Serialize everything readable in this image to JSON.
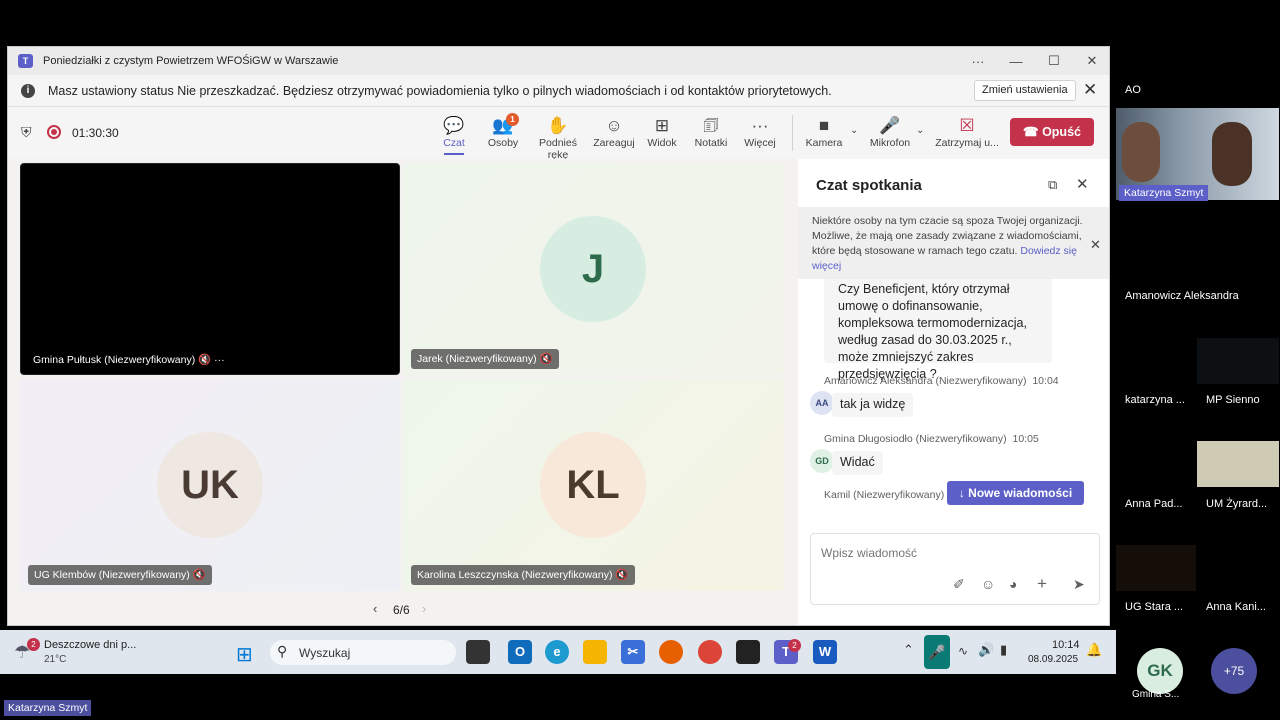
{
  "window": {
    "title": "Poniedziałki z czystym Powietrzem WFOŚiGW w Warszawie"
  },
  "notification": {
    "message": "Masz ustawiony status Nie przeszkadzać. Będziesz otrzymywać powiadomienia tylko o pilnych wiadomościach i od kontaktów priorytetowych.",
    "button": "Zmień ustawienia"
  },
  "toolbar": {
    "timer": "01:30:30",
    "items": [
      {
        "label": "Czat",
        "icon": "chat-icon"
      },
      {
        "label": "Osoby",
        "icon": "people-icon",
        "badge": "1"
      },
      {
        "label": "Podnieś rękę",
        "icon": "raise-hand-icon"
      },
      {
        "label": "Zareaguj",
        "icon": "react-icon"
      },
      {
        "label": "Widok",
        "icon": "view-icon"
      },
      {
        "label": "Notatki",
        "icon": "notes-icon"
      },
      {
        "label": "Więcej",
        "icon": "more-icon"
      },
      {
        "label": "Kamera",
        "icon": "camera-icon"
      },
      {
        "label": "Mikrofon",
        "icon": "mic-icon"
      },
      {
        "label": "Zatrzymaj u...",
        "icon": "stop-share-icon"
      }
    ],
    "leave": "Opuść"
  },
  "tiles": [
    {
      "name": "Gmina Pułtusk (Niezweryfikowany)",
      "initials": ""
    },
    {
      "name": "Jarek (Niezweryfikowany)",
      "initials": "J"
    },
    {
      "name": "UG Klembów (Niezweryfikowany)",
      "initials": "UK"
    },
    {
      "name": "Karolina Leszczynska (Niezweryfikowany)",
      "initials": "KL"
    }
  ],
  "pagination": "6/6",
  "chat": {
    "title": "Czat spotkania",
    "warning": "Niektóre osoby na tym czacie są spoza Twojej organizacji. Możliwe, że mają one zasady związane z wiadomościami, które będą stosowane w ramach tego czatu.",
    "warning_link": "Dowiedz się więcej",
    "partial_message": "Czy Beneficjent, który otrzymał umowę o dofinansowanie, kompleksowa termomodernizacja, według zasad do 30.03.2025 r., może zmniejszyć zakres przedsięwzięcia ?",
    "messages": [
      {
        "author": "Amanowicz Aleksandra (Niezweryfikowany)",
        "time": "10:04",
        "initials": "AA",
        "text": "tak ja widzę"
      },
      {
        "author": "Gmina Długosiodło (Niezweryfikowany)",
        "time": "10:05",
        "initials": "GD",
        "text": "Widać"
      },
      {
        "author": "Kamil (Niezweryfikowany)",
        "time": "",
        "initials": "",
        "text": ""
      }
    ],
    "new_messages": "Nowe wiadomości",
    "compose_placeholder": "Wpisz wiadomość"
  },
  "taskbar": {
    "weather_title": "Deszczowe dni p...",
    "weather_temp": "21°C",
    "weather_badge": "2",
    "search": "Wyszukaj",
    "teams_badge": "2",
    "time": "10:14",
    "date": "08.09.2025"
  },
  "right_panel": {
    "top_initials": "AO",
    "video_name": "Katarzyna Szmyt",
    "participants": [
      "Amanowicz Aleksandra",
      "katarzyna ...",
      "MP Sienno",
      "Anna Pad...",
      "UM Żyrard...",
      "UG Stara ...",
      "Anna Kani..."
    ],
    "gk_initials": "GK",
    "gk_name": "Gmina S...",
    "more_count": "+75"
  },
  "bottom_label": "Katarzyna Szmyt",
  "colors": {
    "accent": "#5b5fc7",
    "leave": "#c4314b",
    "record": "#c4314b"
  }
}
